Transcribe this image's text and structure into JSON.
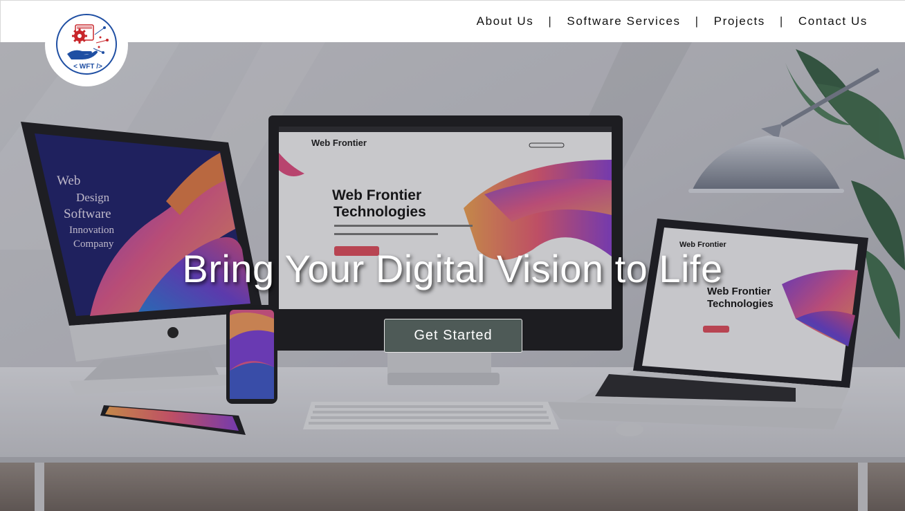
{
  "nav": {
    "items": [
      {
        "label": "About Us"
      },
      {
        "label": "Software Services"
      },
      {
        "label": "Projects"
      },
      {
        "label": "Contact Us"
      }
    ],
    "separator": "|"
  },
  "logo": {
    "text": "< WFT />",
    "icon": "gear-hand-logo-icon",
    "colors": {
      "blue": "#1f4fa3",
      "red": "#c8262b"
    }
  },
  "hero": {
    "title": "Bring Your Digital Vision to Life",
    "cta_label": "Get Started",
    "background": "desk-with-devices-image",
    "left_monitor_text": [
      "Web",
      "Design",
      "Software",
      "Innovation",
      "Company"
    ],
    "center_monitor": {
      "brand": "Web Frontier",
      "heading_line1": "Web Frontier",
      "heading_line2": "Technologies"
    },
    "laptop": {
      "brand": "Web Frontier",
      "heading_line1": "Web Frontier",
      "heading_line2": "Technologies"
    },
    "colors": {
      "cta_bg": "#4e5a57",
      "title": "#ffffff"
    }
  }
}
